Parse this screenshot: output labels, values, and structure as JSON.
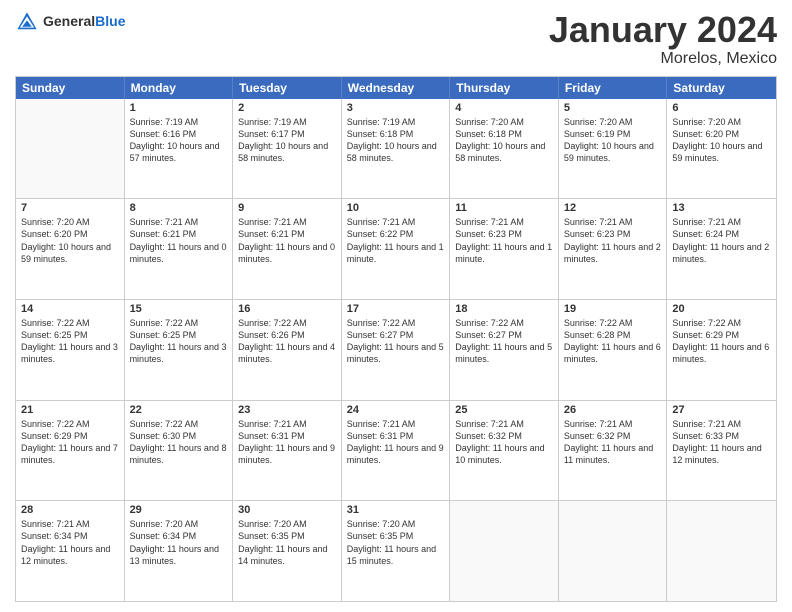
{
  "header": {
    "logo_general": "General",
    "logo_blue": "Blue",
    "month": "January 2024",
    "location": "Morelos, Mexico"
  },
  "days_of_week": [
    "Sunday",
    "Monday",
    "Tuesday",
    "Wednesday",
    "Thursday",
    "Friday",
    "Saturday"
  ],
  "weeks": [
    [
      {
        "day": "",
        "info": ""
      },
      {
        "day": "1",
        "info": "Sunrise: 7:19 AM\nSunset: 6:16 PM\nDaylight: 10 hours and 57 minutes."
      },
      {
        "day": "2",
        "info": "Sunrise: 7:19 AM\nSunset: 6:17 PM\nDaylight: 10 hours and 58 minutes."
      },
      {
        "day": "3",
        "info": "Sunrise: 7:19 AM\nSunset: 6:18 PM\nDaylight: 10 hours and 58 minutes."
      },
      {
        "day": "4",
        "info": "Sunrise: 7:20 AM\nSunset: 6:18 PM\nDaylight: 10 hours and 58 minutes."
      },
      {
        "day": "5",
        "info": "Sunrise: 7:20 AM\nSunset: 6:19 PM\nDaylight: 10 hours and 59 minutes."
      },
      {
        "day": "6",
        "info": "Sunrise: 7:20 AM\nSunset: 6:20 PM\nDaylight: 10 hours and 59 minutes."
      }
    ],
    [
      {
        "day": "7",
        "info": "Sunrise: 7:20 AM\nSunset: 6:20 PM\nDaylight: 10 hours and 59 minutes."
      },
      {
        "day": "8",
        "info": "Sunrise: 7:21 AM\nSunset: 6:21 PM\nDaylight: 11 hours and 0 minutes."
      },
      {
        "day": "9",
        "info": "Sunrise: 7:21 AM\nSunset: 6:21 PM\nDaylight: 11 hours and 0 minutes."
      },
      {
        "day": "10",
        "info": "Sunrise: 7:21 AM\nSunset: 6:22 PM\nDaylight: 11 hours and 1 minute."
      },
      {
        "day": "11",
        "info": "Sunrise: 7:21 AM\nSunset: 6:23 PM\nDaylight: 11 hours and 1 minute."
      },
      {
        "day": "12",
        "info": "Sunrise: 7:21 AM\nSunset: 6:23 PM\nDaylight: 11 hours and 2 minutes."
      },
      {
        "day": "13",
        "info": "Sunrise: 7:21 AM\nSunset: 6:24 PM\nDaylight: 11 hours and 2 minutes."
      }
    ],
    [
      {
        "day": "14",
        "info": "Sunrise: 7:22 AM\nSunset: 6:25 PM\nDaylight: 11 hours and 3 minutes."
      },
      {
        "day": "15",
        "info": "Sunrise: 7:22 AM\nSunset: 6:25 PM\nDaylight: 11 hours and 3 minutes."
      },
      {
        "day": "16",
        "info": "Sunrise: 7:22 AM\nSunset: 6:26 PM\nDaylight: 11 hours and 4 minutes."
      },
      {
        "day": "17",
        "info": "Sunrise: 7:22 AM\nSunset: 6:27 PM\nDaylight: 11 hours and 5 minutes."
      },
      {
        "day": "18",
        "info": "Sunrise: 7:22 AM\nSunset: 6:27 PM\nDaylight: 11 hours and 5 minutes."
      },
      {
        "day": "19",
        "info": "Sunrise: 7:22 AM\nSunset: 6:28 PM\nDaylight: 11 hours and 6 minutes."
      },
      {
        "day": "20",
        "info": "Sunrise: 7:22 AM\nSunset: 6:29 PM\nDaylight: 11 hours and 6 minutes."
      }
    ],
    [
      {
        "day": "21",
        "info": "Sunrise: 7:22 AM\nSunset: 6:29 PM\nDaylight: 11 hours and 7 minutes."
      },
      {
        "day": "22",
        "info": "Sunrise: 7:22 AM\nSunset: 6:30 PM\nDaylight: 11 hours and 8 minutes."
      },
      {
        "day": "23",
        "info": "Sunrise: 7:21 AM\nSunset: 6:31 PM\nDaylight: 11 hours and 9 minutes."
      },
      {
        "day": "24",
        "info": "Sunrise: 7:21 AM\nSunset: 6:31 PM\nDaylight: 11 hours and 9 minutes."
      },
      {
        "day": "25",
        "info": "Sunrise: 7:21 AM\nSunset: 6:32 PM\nDaylight: 11 hours and 10 minutes."
      },
      {
        "day": "26",
        "info": "Sunrise: 7:21 AM\nSunset: 6:32 PM\nDaylight: 11 hours and 11 minutes."
      },
      {
        "day": "27",
        "info": "Sunrise: 7:21 AM\nSunset: 6:33 PM\nDaylight: 11 hours and 12 minutes."
      }
    ],
    [
      {
        "day": "28",
        "info": "Sunrise: 7:21 AM\nSunset: 6:34 PM\nDaylight: 11 hours and 12 minutes."
      },
      {
        "day": "29",
        "info": "Sunrise: 7:20 AM\nSunset: 6:34 PM\nDaylight: 11 hours and 13 minutes."
      },
      {
        "day": "30",
        "info": "Sunrise: 7:20 AM\nSunset: 6:35 PM\nDaylight: 11 hours and 14 minutes."
      },
      {
        "day": "31",
        "info": "Sunrise: 7:20 AM\nSunset: 6:35 PM\nDaylight: 11 hours and 15 minutes."
      },
      {
        "day": "",
        "info": ""
      },
      {
        "day": "",
        "info": ""
      },
      {
        "day": "",
        "info": ""
      }
    ]
  ]
}
